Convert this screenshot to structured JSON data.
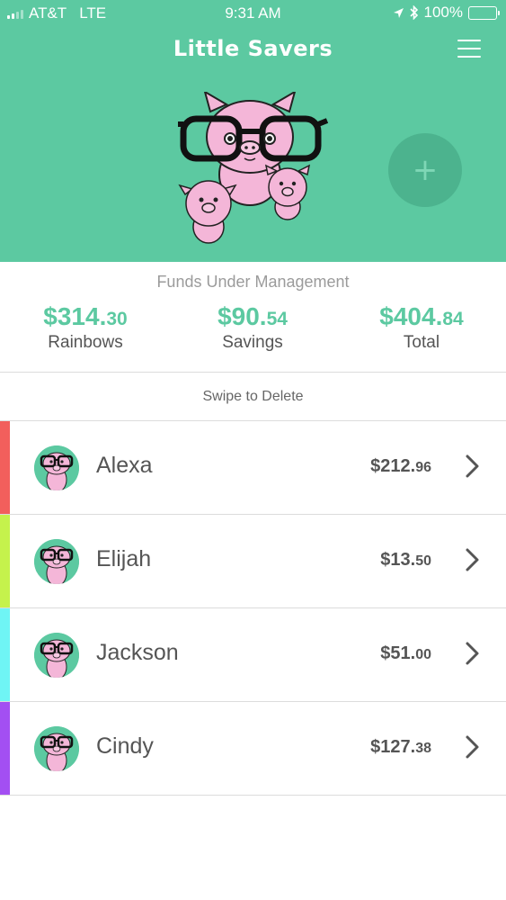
{
  "status_bar": {
    "carrier": "AT&T",
    "network": "LTE",
    "time": "9:31 AM",
    "battery": "100%"
  },
  "app": {
    "title": "Little Savers"
  },
  "icons": {
    "menu": "hamburger-menu-icon",
    "add": "plus-icon",
    "chevron": "chevron-right-icon"
  },
  "colors": {
    "brand": "#5cc9a1",
    "alexa": "#f25f5c",
    "elijah": "#c5f24c",
    "jackson": "#6ff5f5",
    "cindy": "#a34ff2"
  },
  "summary": {
    "title": "Funds Under Management",
    "stats": [
      {
        "dollars": "$314.",
        "cents": "30",
        "label": "Rainbows"
      },
      {
        "dollars": "$90.",
        "cents": "54",
        "label": "Savings"
      },
      {
        "dollars": "$404.",
        "cents": "84",
        "label": "Total"
      }
    ]
  },
  "hint": "Swipe to Delete",
  "kids": [
    {
      "name": "Alexa",
      "dollars": "$212.",
      "cents": "96",
      "color": "#f25f5c"
    },
    {
      "name": "Elijah",
      "dollars": "$13.",
      "cents": "50",
      "color": "#c5f24c"
    },
    {
      "name": "Jackson",
      "dollars": "$51.",
      "cents": "00",
      "color": "#6ff5f5"
    },
    {
      "name": "Cindy",
      "dollars": "$127.",
      "cents": "38",
      "color": "#a34ff2"
    }
  ]
}
